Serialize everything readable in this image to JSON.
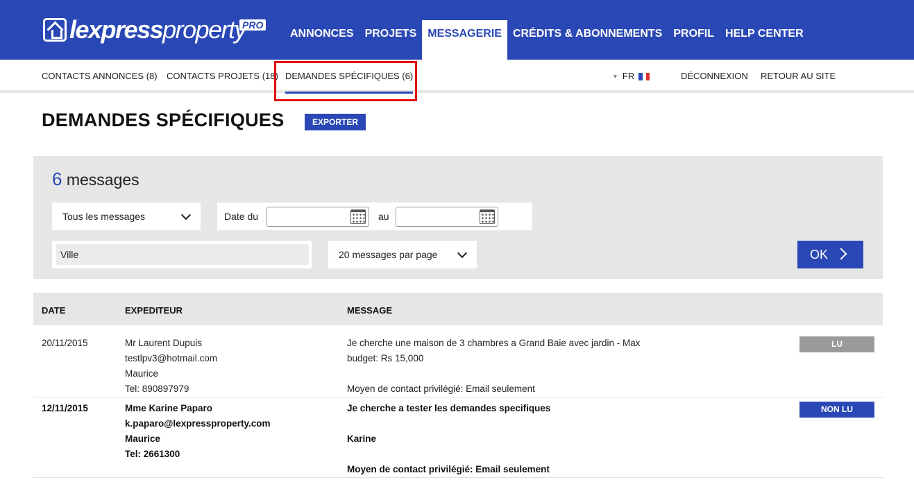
{
  "brand": {
    "name_bold": "lexpress",
    "name_light": "property",
    "tag": "PRO"
  },
  "main_nav": [
    {
      "label": "ANNONCES"
    },
    {
      "label": "PROJETS"
    },
    {
      "label": "MESSAGERIE",
      "active": true
    },
    {
      "label": "CRÉDITS & ABONNEMENTS"
    },
    {
      "label": "PROFIL"
    },
    {
      "label": "HELP CENTER"
    }
  ],
  "sub_nav": {
    "items": [
      {
        "label": "CONTACTS ANNONCES (8)"
      },
      {
        "label": "CONTACTS PROJETS (18)"
      },
      {
        "label": "DEMANDES SPÉCIFIQUES (6)",
        "active": true
      }
    ],
    "language": "FR",
    "logout": "DÉCONNEXION",
    "back": "RETOUR AU SITE"
  },
  "page": {
    "title": "DEMANDES SPÉCIFIQUES",
    "export_label": "EXPORTER"
  },
  "filters": {
    "count": "6",
    "count_label": "messages",
    "message_filter": "Tous les messages",
    "date_from_label": "Date du",
    "date_to_label": "au",
    "date_from_value": "",
    "date_to_value": "",
    "city_value": "Ville",
    "per_page": "20 messages par page",
    "ok_label": "OK"
  },
  "table": {
    "headers": {
      "date": "DATE",
      "sender": "EXPEDITEUR",
      "message": "MESSAGE"
    },
    "rows": [
      {
        "date": "20/11/2015",
        "name": "Mr Laurent Dupuis",
        "email": "testlpv3@hotmail.com",
        "country": "Maurice",
        "tel": "Tel: 890897979",
        "message_line1": "Je cherche une maison de 3 chambres a Grand Baie avec jardin - Max",
        "message_line2": "budget: Rs 15,000",
        "contact_pref": "Moyen de contact privilégié: Email seulement",
        "status": "LU"
      },
      {
        "date": "12/11/2015",
        "name": "Mme Karine Paparo",
        "email": "k.paparo@lexpressproperty.com",
        "country": "Maurice",
        "tel": "Tel: 2661300",
        "message_line1": "Je cherche a tester les demandes specifiques",
        "message_line2": "Karine",
        "contact_pref": "Moyen de contact privilégié: Email seulement",
        "status": "NON LU"
      }
    ]
  },
  "colors": {
    "brand_blue": "#2a48b5",
    "highlight_red": "#e01010",
    "read_gray": "#9a9a9a"
  }
}
